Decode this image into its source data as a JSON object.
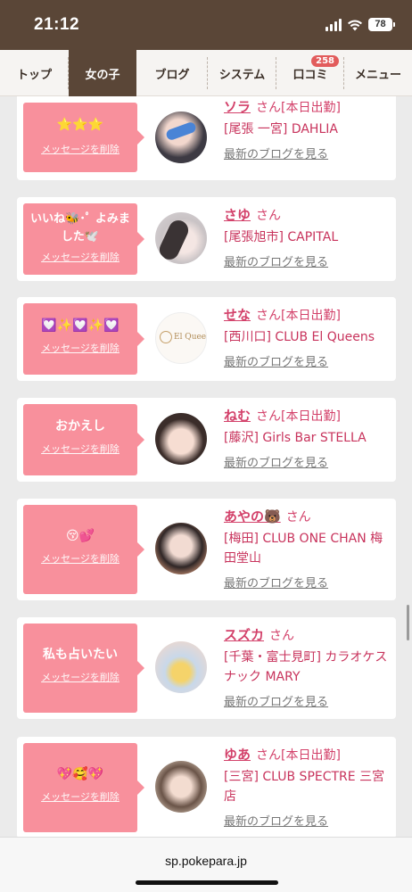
{
  "status": {
    "time": "21:12",
    "battery": "78"
  },
  "nav": {
    "items": [
      {
        "label": "トップ"
      },
      {
        "label": "女の子"
      },
      {
        "label": "ブログ"
      },
      {
        "label": "システム"
      },
      {
        "label": "口コミ",
        "badge": "258"
      },
      {
        "label": "メニュー"
      }
    ]
  },
  "messages": [
    {
      "message": "⭐⭐⭐",
      "delete_label": "メッセージを削除",
      "name": "ソラ",
      "suffix": "さん[本日出勤]",
      "shop": "[尾張 一宮] DAHLIA",
      "blog_link": "最新のブログを見る"
    },
    {
      "message": "いいね🐝･ﾟ よみました🕊️",
      "delete_label": "メッセージを削除",
      "name": "さゆ",
      "suffix": "さん",
      "shop": "[尾張旭市] CAPITAL",
      "blog_link": "最新のブログを見る"
    },
    {
      "message": "💟✨💟✨💟",
      "delete_label": "メッセージを削除",
      "name": "せな",
      "suffix": "さん[本日出勤]",
      "shop": "[西川口] CLUB El Queens",
      "blog_link": "最新のブログを見る"
    },
    {
      "message": "おかえし",
      "delete_label": "メッセージを削除",
      "name": "ねむ",
      "suffix": "さん[本日出勤]",
      "shop": "[藤沢] Girls Bar STELLA",
      "blog_link": "最新のブログを見る"
    },
    {
      "message": "😚💕",
      "delete_label": "メッセージを削除",
      "name": "あやの🐻",
      "suffix": "さん",
      "shop": "[梅田] CLUB ONE CHAN 梅田堂山",
      "blog_link": "最新のブログを見る"
    },
    {
      "message": "私も占いたい",
      "delete_label": "メッセージを削除",
      "name": "スズカ",
      "suffix": "さん",
      "shop": "[千葉・富士見町] カラオケスナック MARY",
      "blog_link": "最新のブログを見る"
    },
    {
      "message": "💖🥰💖",
      "delete_label": "メッセージを削除",
      "name": "ゆあ",
      "suffix": "さん[本日出勤]",
      "shop": "[三宮] CLUB SPECTRE 三宮店",
      "blog_link": "最新のブログを見る"
    }
  ],
  "logo_text": "El Queens",
  "browser": {
    "url": "sp.pokepara.jp"
  },
  "colors": {
    "header": "#5a4637",
    "bubble": "#f8909c",
    "accent": "#d3416a"
  }
}
